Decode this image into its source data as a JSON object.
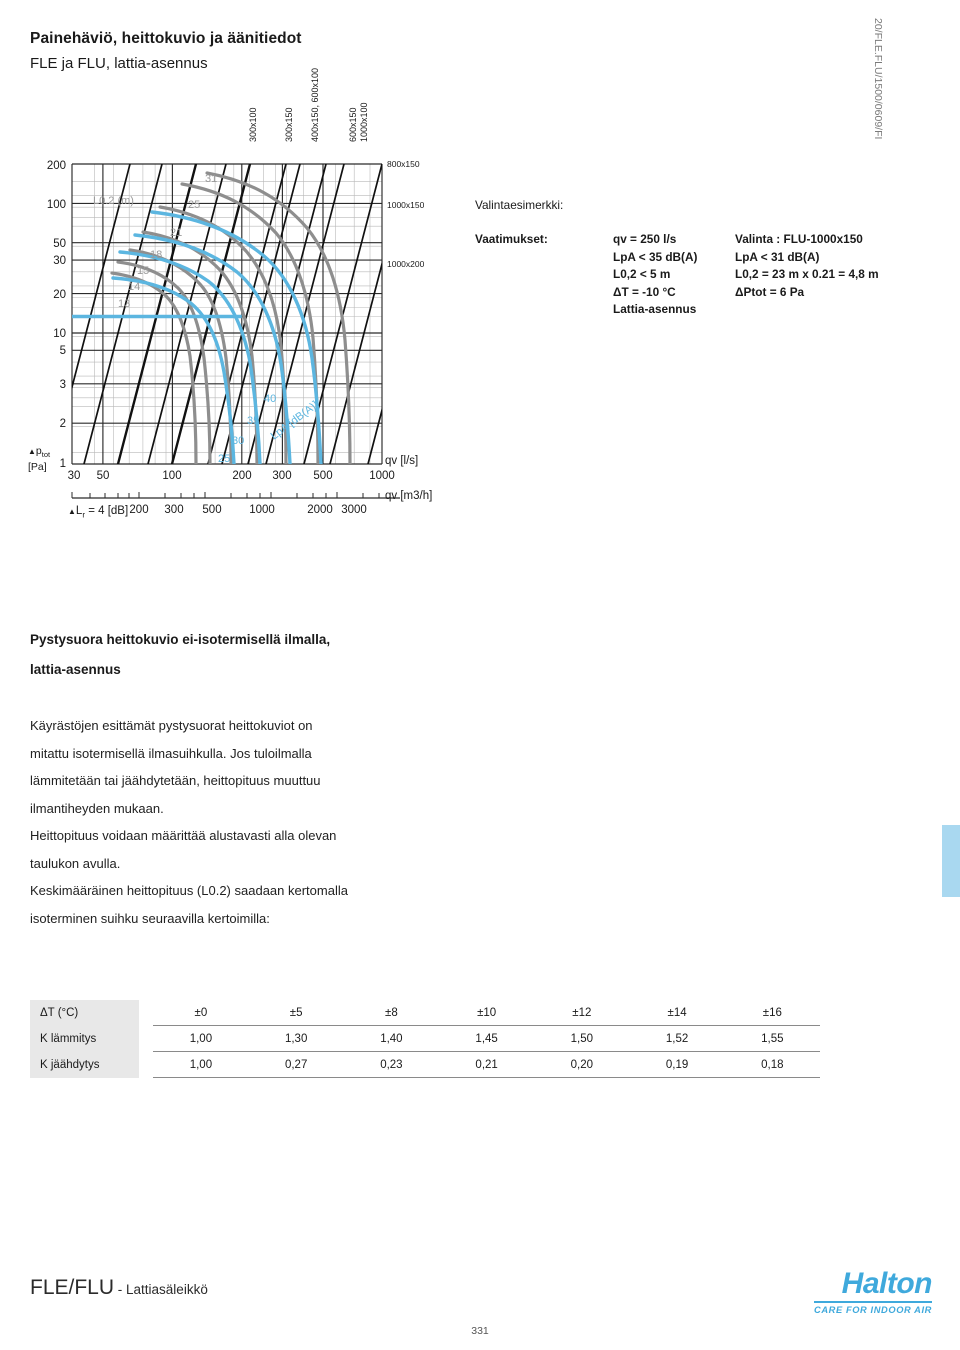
{
  "header": {
    "title": "Painehäviö, heittokuvio ja äänitiedot",
    "subtitle": "FLE ja FLU, lattia-asennus",
    "doc_code": "20/FLE.FLU/1500/0609/FI"
  },
  "chart_data": {
    "type": "line",
    "title": "",
    "xlabel": "qv [l/s]",
    "xlabel_secondary": "qv [m3/h]",
    "ylabel": "Δptot [Pa]",
    "xlim": [
      30,
      1000
    ],
    "ylim": [
      1,
      200
    ],
    "grid": true,
    "x_ticks": [
      "30",
      "50",
      "100",
      "200",
      "300",
      "500",
      "1000"
    ],
    "x_tick_values": [
      30,
      50,
      100,
      200,
      300,
      500,
      1000
    ],
    "x_ticks_secondary": [
      "200",
      "300",
      "500",
      "1000",
      "2000",
      "3000"
    ],
    "x_tick_values_secondary": [
      200,
      300,
      500,
      1000,
      2000,
      3000
    ],
    "y_ticks": [
      "1",
      "2",
      "3",
      "5",
      "10",
      "20",
      "30",
      "50",
      "100",
      "200"
    ],
    "y_tick_values": [
      1,
      2,
      3,
      5,
      10,
      20,
      30,
      50,
      100,
      200
    ],
    "note": "ΔLr = 4 [dB]",
    "top_labels": [
      "300x100",
      "300x150",
      "400x150, 600x100",
      "600x150\n1000x100"
    ],
    "right_labels": [
      "800x150",
      "1000x150",
      "1000x200"
    ],
    "series_groups": [
      {
        "name": "Δptot duct-size lines",
        "color": "#1a1a1a",
        "labels": [
          "300x100",
          "300x150",
          "400x150, 600x100",
          "600x150",
          "1000x100",
          "800x150",
          "1000x150",
          "1000x200"
        ]
      },
      {
        "name": "L0.2 (m)",
        "color": "#9a9a9a",
        "label": "L0.2 (m)",
        "values": [
          31,
          25,
          21,
          18,
          15,
          14,
          13
        ]
      },
      {
        "name": "LpA [dB(A)]",
        "color": "#5cb6e0",
        "label": "LpA [dB(A)]",
        "values": [
          40,
          35,
          30,
          25
        ]
      }
    ],
    "selection_marker": {
      "qv": 250,
      "dptot": 6,
      "description": "horizontal blue selection line at Δptot = 6 Pa"
    }
  },
  "example": {
    "heading": "Valintaesimerkki:",
    "requirements_label": "Vaatimukset:",
    "requirements": [
      "qv = 250 l/s",
      "LpA < 35 dB(A)",
      "L0,2 < 5 m",
      "ΔT = -10 °C",
      "Lattia-asennus"
    ],
    "selection": [
      "Valinta : FLU-1000x150",
      "LpA < 31 dB(A)",
      "L0,2 = 23 m x 0.21 = 4,8 m",
      "ΔPtot = 6 Pa"
    ]
  },
  "section": {
    "heading_line1": "Pystysuora heittokuvio ei-isotermisellä ilmalla,",
    "heading_line2": "lattia-asennus",
    "paragraphs": [
      "Käyrästöjen esittämät pystysuorat heittokuviot on",
      "mitattu isotermisellä ilmasuihkulla. Jos tuloilmalla",
      "lämmitetään tai jäähdytetään, heittopituus muuttuu",
      "ilmantiheyden mukaan.",
      "Heittopituus voidaan määrittää alustavasti alla olevan",
      "taulukon avulla.",
      "Keskimääräinen heittopituus (L0.2) saadaan kertomalla",
      "isoterminen suihku seuraavilla kertoimilla:"
    ]
  },
  "table": {
    "rows": [
      {
        "label": "ΔT (°C)",
        "values": [
          "±0",
          "±5",
          "±8",
          "±10",
          "±12",
          "±14",
          "±16"
        ]
      },
      {
        "label": "K lämmitys",
        "values": [
          "1,00",
          "1,30",
          "1,40",
          "1,45",
          "1,50",
          "1,52",
          "1,55"
        ]
      },
      {
        "label": "K jäähdytys",
        "values": [
          "1,00",
          "0,27",
          "0,23",
          "0,21",
          "0,20",
          "0,19",
          "0,18"
        ]
      }
    ]
  },
  "footer": {
    "product": "FLE/FLU",
    "product_sub": " - Lattiasäleikkö",
    "page_number": "331",
    "logo_word": "Halton",
    "logo_tagline": "CARE FOR INDOOR AIR",
    "brand_color": "#3fa9dc"
  }
}
